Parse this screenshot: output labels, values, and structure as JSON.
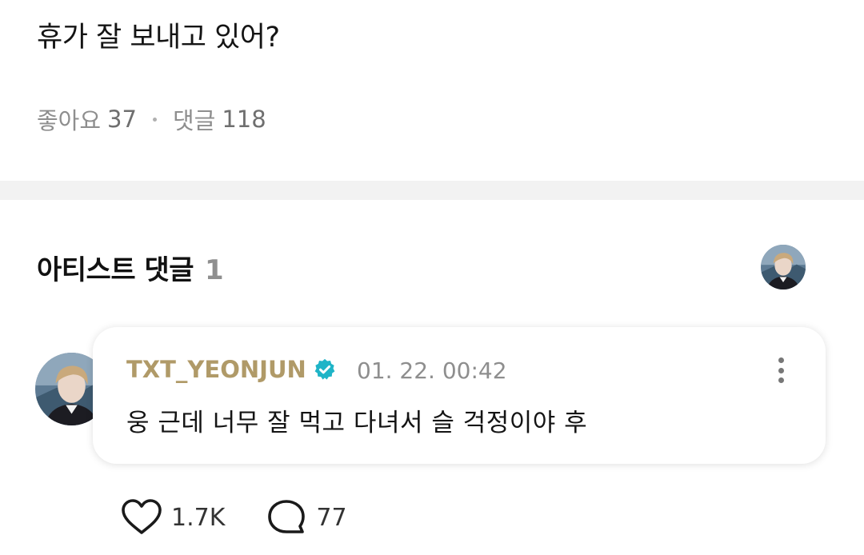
{
  "post": {
    "text": "휴가 잘 보내고 있어?",
    "likes_label": "좋아요",
    "likes_count": "37",
    "comments_label": "댓글",
    "comments_count": "118"
  },
  "artist_comments": {
    "title": "아티스트 댓글",
    "count": "1"
  },
  "comment": {
    "author": "TXT_YEONJUN",
    "time": "01. 22. 00:42",
    "body": "웅 근데 너무 잘 먹고 다녀서 슬 걱정이야 후",
    "likes": "1.7K",
    "replies": "77"
  },
  "icons": {
    "verified": "verified-check-icon",
    "more": "more-vertical-icon",
    "like": "heart-icon",
    "reply": "speech-bubble-icon"
  },
  "colors": {
    "author_gold": "#b09a68",
    "verified_teal": "#1fb4c7",
    "muted_gray": "#8e8e8e",
    "divider": "#f2f2f2"
  }
}
